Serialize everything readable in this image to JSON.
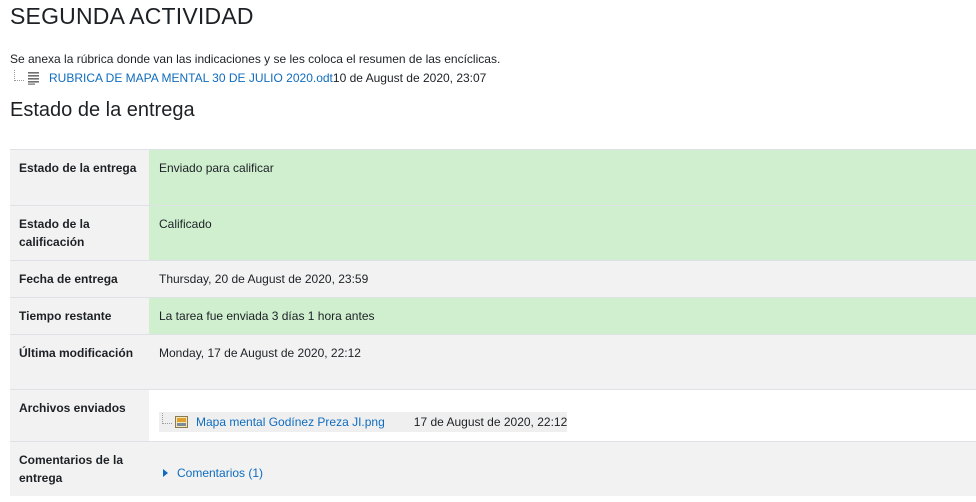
{
  "page": {
    "title": "SEGUNDA ACTIVIDAD",
    "intro": "Se anexa la rúbrica donde van las indicaciones y se les coloca el resumen de las encíclicas."
  },
  "attachment": {
    "icon": "document-icon",
    "filename": "RUBRICA DE MAPA MENTAL 30 DE JULIO 2020.odt",
    "date": "10 de August de 2020, 23:07"
  },
  "submission": {
    "heading": "Estado de la entrega",
    "rows": {
      "submission_status": {
        "label": "Estado de la entrega",
        "value": "Enviado para calificar"
      },
      "grading_status": {
        "label": "Estado de la calificación",
        "value": "Calificado"
      },
      "due_date": {
        "label": "Fecha de entrega",
        "value": "Thursday, 20 de August de 2020, 23:59"
      },
      "time_remaining": {
        "label": "Tiempo restante",
        "value": "La tarea fue enviada 3 días 1 hora antes"
      },
      "last_modified": {
        "label": "Última modificación",
        "value": "Monday, 17 de August de 2020, 22:12"
      },
      "files": {
        "label": "Archivos enviados",
        "file": {
          "icon": "image-file-icon",
          "name": "Mapa mental Godínez Preza JI.png",
          "date": "17 de August de 2020, 22:12"
        }
      },
      "comments": {
        "label": "Comentarios de la entrega",
        "link": "Comentarios (1)"
      }
    }
  },
  "colors": {
    "success_bg": "#cfefcf",
    "header_bg": "#f2f2f2",
    "link": "#0f6cbf"
  }
}
